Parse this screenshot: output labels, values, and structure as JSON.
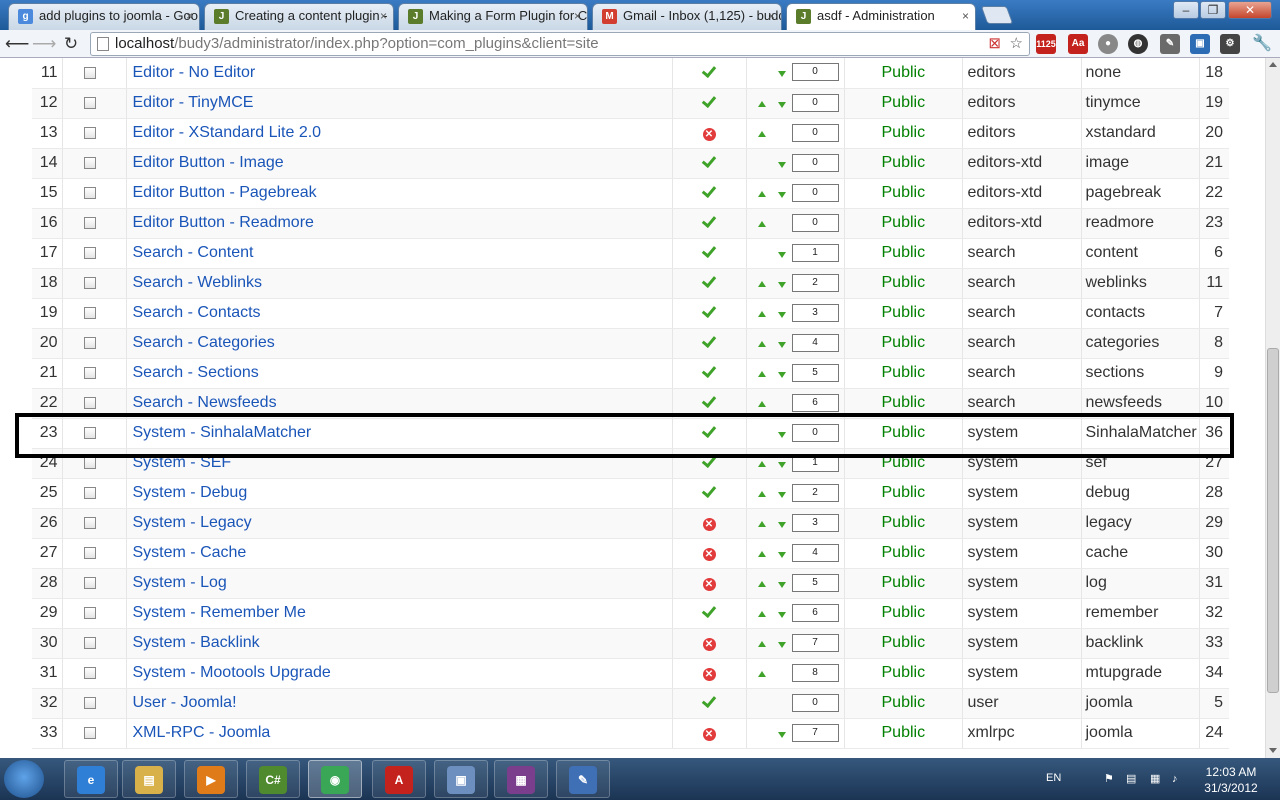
{
  "browser": {
    "tabs": [
      {
        "title": "add plugins to joomla - Goo",
        "favicon": "google-icon",
        "color": "#4a89dc",
        "glyph": "g"
      },
      {
        "title": "Creating a content plugin -",
        "favicon": "joomla-icon",
        "color": "#5b7c2a",
        "glyph": "J"
      },
      {
        "title": "Making a Form Plugin for C",
        "favicon": "joomla-icon",
        "color": "#5b7c2a",
        "glyph": "J"
      },
      {
        "title": "Gmail - Inbox (1,125) - budd",
        "favicon": "gmail-icon",
        "color": "#d23f31",
        "glyph": "M"
      },
      {
        "title": "asdf - Administration",
        "favicon": "joomla-icon",
        "color": "#5b7c2a",
        "glyph": "J"
      }
    ],
    "close_glyph": "×",
    "url_host": "localhost",
    "url_path": "/budy3/administrator/index.php?option=com_plugins&client=site",
    "badge_count": "1125"
  },
  "plugins": [
    {
      "num": "11",
      "name": "Editor - No Editor",
      "enabled": true,
      "up": false,
      "down": true,
      "order": "0",
      "access": "Public",
      "folder": "editors",
      "element": "none",
      "id": "18"
    },
    {
      "num": "12",
      "name": "Editor - TinyMCE",
      "enabled": true,
      "up": true,
      "down": true,
      "order": "0",
      "access": "Public",
      "folder": "editors",
      "element": "tinymce",
      "id": "19"
    },
    {
      "num": "13",
      "name": "Editor - XStandard Lite 2.0",
      "enabled": false,
      "up": true,
      "down": false,
      "order": "0",
      "access": "Public",
      "folder": "editors",
      "element": "xstandard",
      "id": "20"
    },
    {
      "num": "14",
      "name": "Editor Button - Image",
      "enabled": true,
      "up": false,
      "down": true,
      "order": "0",
      "access": "Public",
      "folder": "editors-xtd",
      "element": "image",
      "id": "21"
    },
    {
      "num": "15",
      "name": "Editor Button - Pagebreak",
      "enabled": true,
      "up": true,
      "down": true,
      "order": "0",
      "access": "Public",
      "folder": "editors-xtd",
      "element": "pagebreak",
      "id": "22"
    },
    {
      "num": "16",
      "name": "Editor Button - Readmore",
      "enabled": true,
      "up": true,
      "down": false,
      "order": "0",
      "access": "Public",
      "folder": "editors-xtd",
      "element": "readmore",
      "id": "23"
    },
    {
      "num": "17",
      "name": "Search - Content",
      "enabled": true,
      "up": false,
      "down": true,
      "order": "1",
      "access": "Public",
      "folder": "search",
      "element": "content",
      "id": "6"
    },
    {
      "num": "18",
      "name": "Search - Weblinks",
      "enabled": true,
      "up": true,
      "down": true,
      "order": "2",
      "access": "Public",
      "folder": "search",
      "element": "weblinks",
      "id": "11"
    },
    {
      "num": "19",
      "name": "Search - Contacts",
      "enabled": true,
      "up": true,
      "down": true,
      "order": "3",
      "access": "Public",
      "folder": "search",
      "element": "contacts",
      "id": "7"
    },
    {
      "num": "20",
      "name": "Search - Categories",
      "enabled": true,
      "up": true,
      "down": true,
      "order": "4",
      "access": "Public",
      "folder": "search",
      "element": "categories",
      "id": "8"
    },
    {
      "num": "21",
      "name": "Search - Sections",
      "enabled": true,
      "up": true,
      "down": true,
      "order": "5",
      "access": "Public",
      "folder": "search",
      "element": "sections",
      "id": "9"
    },
    {
      "num": "22",
      "name": "Search - Newsfeeds",
      "enabled": true,
      "up": true,
      "down": false,
      "order": "6",
      "access": "Public",
      "folder": "search",
      "element": "newsfeeds",
      "id": "10"
    },
    {
      "num": "23",
      "name": "System - SinhalaMatcher",
      "enabled": true,
      "up": false,
      "down": true,
      "order": "0",
      "access": "Public",
      "folder": "system",
      "element": "SinhalaMatcher",
      "id": "36"
    },
    {
      "num": "24",
      "name": "System - SEF",
      "enabled": true,
      "up": true,
      "down": true,
      "order": "1",
      "access": "Public",
      "folder": "system",
      "element": "sef",
      "id": "27"
    },
    {
      "num": "25",
      "name": "System - Debug",
      "enabled": true,
      "up": true,
      "down": true,
      "order": "2",
      "access": "Public",
      "folder": "system",
      "element": "debug",
      "id": "28"
    },
    {
      "num": "26",
      "name": "System - Legacy",
      "enabled": false,
      "up": true,
      "down": true,
      "order": "3",
      "access": "Public",
      "folder": "system",
      "element": "legacy",
      "id": "29"
    },
    {
      "num": "27",
      "name": "System - Cache",
      "enabled": false,
      "up": true,
      "down": true,
      "order": "4",
      "access": "Public",
      "folder": "system",
      "element": "cache",
      "id": "30"
    },
    {
      "num": "28",
      "name": "System - Log",
      "enabled": false,
      "up": true,
      "down": true,
      "order": "5",
      "access": "Public",
      "folder": "system",
      "element": "log",
      "id": "31"
    },
    {
      "num": "29",
      "name": "System - Remember Me",
      "enabled": true,
      "up": true,
      "down": true,
      "order": "6",
      "access": "Public",
      "folder": "system",
      "element": "remember",
      "id": "32"
    },
    {
      "num": "30",
      "name": "System - Backlink",
      "enabled": false,
      "up": true,
      "down": true,
      "order": "7",
      "access": "Public",
      "folder": "system",
      "element": "backlink",
      "id": "33"
    },
    {
      "num": "31",
      "name": "System - Mootools Upgrade",
      "enabled": false,
      "up": true,
      "down": false,
      "order": "8",
      "access": "Public",
      "folder": "system",
      "element": "mtupgrade",
      "id": "34"
    },
    {
      "num": "32",
      "name": "User - Joomla!",
      "enabled": true,
      "up": false,
      "down": false,
      "order": "0",
      "access": "Public",
      "folder": "user",
      "element": "joomla",
      "id": "5"
    },
    {
      "num": "33",
      "name": "XML-RPC - Joomla",
      "enabled": false,
      "up": false,
      "down": true,
      "order": "7",
      "access": "Public",
      "folder": "xmlrpc",
      "element": "joomla",
      "id": "24"
    }
  ],
  "highlighted_row": "23",
  "taskbar": {
    "items": [
      {
        "name": "taskbar-ie-icon",
        "label": "e",
        "color": "#2f7fd6"
      },
      {
        "name": "taskbar-explorer-icon",
        "label": "▤",
        "color": "#d9b14a"
      },
      {
        "name": "taskbar-media-player-icon",
        "label": "▶",
        "color": "#e07b1a"
      },
      {
        "name": "taskbar-csharp-icon",
        "label": "C#",
        "color": "#4f8a2f"
      },
      {
        "name": "taskbar-chrome-icon",
        "label": "◉",
        "color": "#3aa757"
      },
      {
        "name": "taskbar-acrobat-icon",
        "label": "A",
        "color": "#c4231d"
      },
      {
        "name": "taskbar-virtualbox-icon",
        "label": "▣",
        "color": "#6d8fbf"
      },
      {
        "name": "taskbar-winrar-icon",
        "label": "▦",
        "color": "#7b3e8c"
      },
      {
        "name": "taskbar-app-icon",
        "label": "✎",
        "color": "#3f6fb5"
      }
    ],
    "language": "EN",
    "time": "12:03 AM",
    "date": "31/3/2012"
  },
  "colors": {
    "link": "#1a55b8",
    "access": "#008000",
    "enabled": "#3fa32a",
    "disabled": "#e23b3b"
  }
}
